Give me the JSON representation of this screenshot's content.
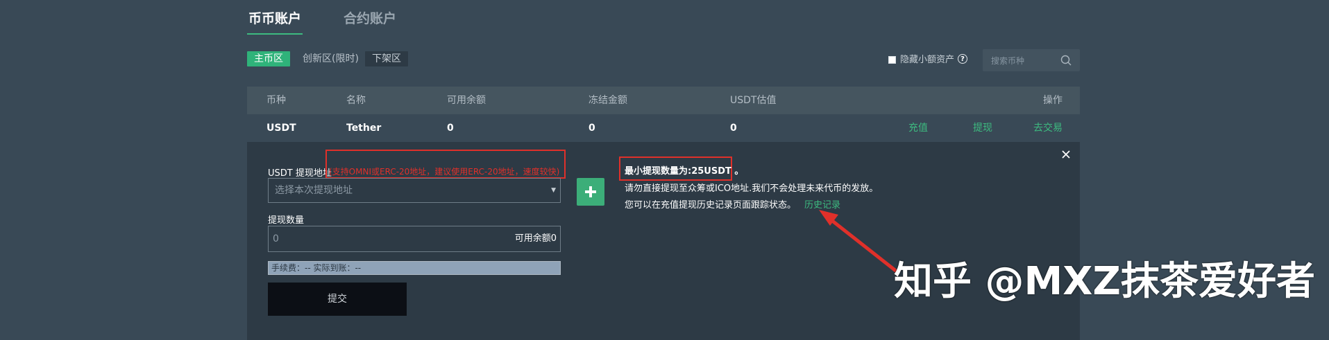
{
  "account_tabs": {
    "spot": "币币账户",
    "contract": "合约账户"
  },
  "zones": {
    "main": "主币区",
    "innovation": "创新区(限时)",
    "delisted": "下架区"
  },
  "filters": {
    "hide_small_label": "隐藏小额资产",
    "help_glyph": "?",
    "search_placeholder": "搜索币种"
  },
  "table": {
    "headers": [
      "币种",
      "名称",
      "可用余额",
      "冻结金额",
      "USDT估值",
      "操作"
    ],
    "rows": [
      {
        "coin": "USDT",
        "name": "Tether",
        "available": "0",
        "frozen": "0",
        "usdt_value": "0",
        "actions": [
          "充值",
          "提现",
          "去交易"
        ]
      }
    ]
  },
  "withdraw_panel": {
    "address_label": "USDT 提现地址",
    "address_note": "(支持OMNI或ERC-20地址，建议使用ERC-20地址，速度较快)",
    "address_placeholder": "选择本次提现地址",
    "amount_label": "提现数量",
    "amount_placeholder": "0",
    "available_label": "可用余额0",
    "fee_text": "手续费：-- 实际到账：--",
    "submit_label": "提交",
    "min_amount_text": "最小提现数量为:25USDT 。",
    "warning_text": "请勿直接提现至众筹或ICO地址.我们不会处理未来代币的发放。",
    "track_text": "您可以在充值提现历史记录页面跟踪状态。",
    "history_link": "历史记录"
  },
  "watermark": "知乎 @MXZ抹茶爱好者",
  "colors": {
    "accent": "#3dbb80",
    "annotation_red": "#e0302a",
    "background": "#394956",
    "panel": "#2d3a45"
  },
  "icons": [
    "checkbox-icon",
    "help-icon",
    "search-icon",
    "dropdown-caret-icon",
    "plus-icon",
    "close-icon",
    "annotation-arrow-icon"
  ]
}
